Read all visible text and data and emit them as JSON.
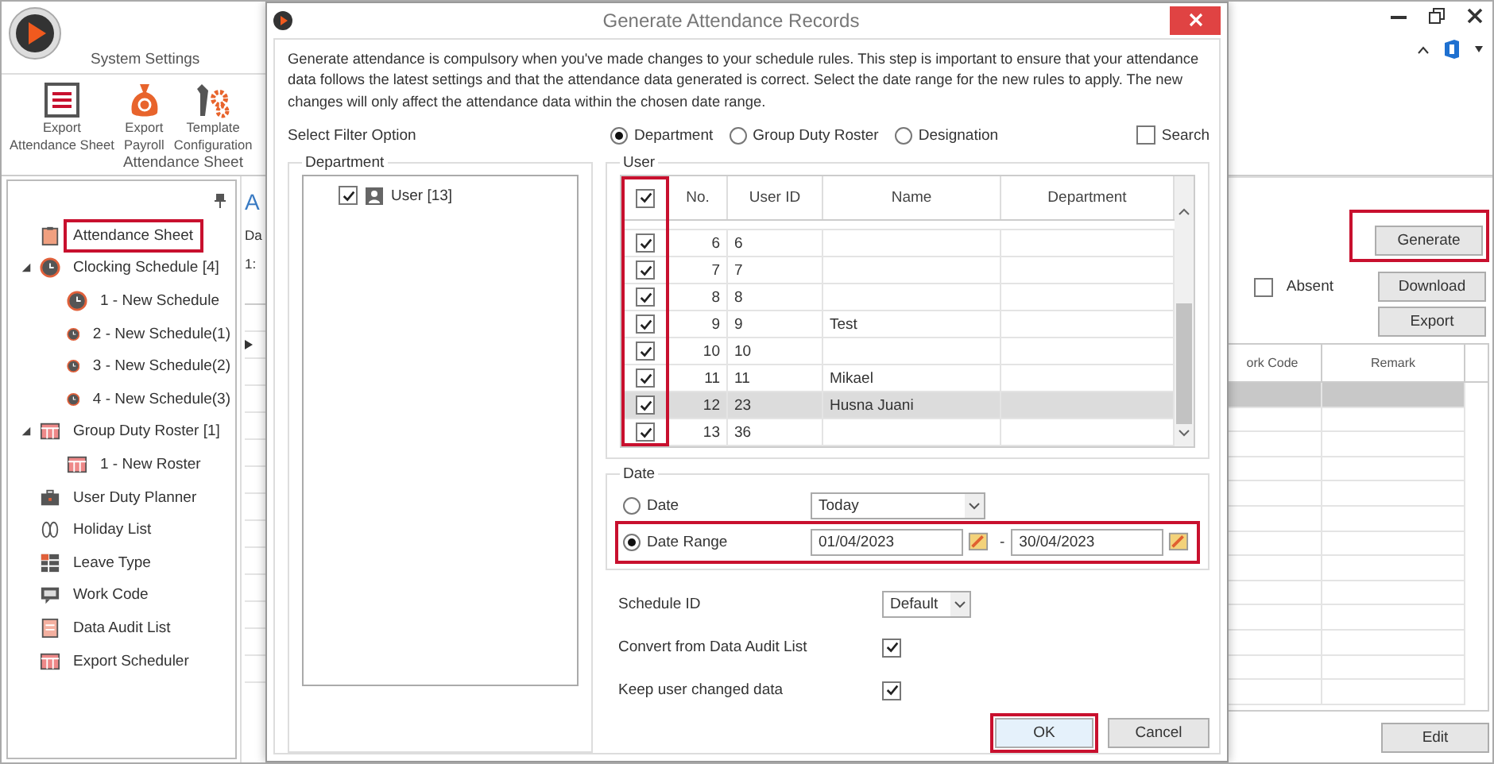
{
  "ribbon": {
    "tab": "System Settings",
    "tools": [
      {
        "kind": "sheet",
        "lines": [
          "Export",
          "Attendance Sheet"
        ]
      },
      {
        "kind": "payroll",
        "lines": [
          "Export",
          "Payroll"
        ]
      },
      {
        "kind": "config",
        "lines": [
          "Template",
          "Configuration"
        ]
      }
    ],
    "group_label": "Attendance Sheet"
  },
  "navigation": {
    "items": [
      {
        "kind": "sheet",
        "label": "Attendance Sheet",
        "highlighted": true
      },
      {
        "kind": "clock",
        "label": "Clocking Schedule [4]",
        "expanded": true,
        "children": [
          {
            "kind": "clock",
            "label": "1 - New Schedule"
          },
          {
            "kind": "clock",
            "label": "2 - New Schedule(1)"
          },
          {
            "kind": "clock",
            "label": "3 - New Schedule(2)"
          },
          {
            "kind": "clock",
            "label": "4 - New Schedule(3)"
          }
        ]
      },
      {
        "kind": "roster",
        "label": "Group Duty Roster [1]",
        "expanded": true,
        "children": [
          {
            "kind": "roster",
            "label": "1 - New Roster"
          }
        ]
      },
      {
        "kind": "planner",
        "label": "User Duty Planner"
      },
      {
        "kind": "holiday",
        "label": "Holiday List"
      },
      {
        "kind": "leave",
        "label": "Leave Type"
      },
      {
        "kind": "code",
        "label": "Work Code"
      },
      {
        "kind": "audit",
        "label": "Data Audit List"
      },
      {
        "kind": "export",
        "label": "Export Scheduler"
      }
    ]
  },
  "content": {
    "title": "A",
    "field_label": "Da",
    "field_value": "1:"
  },
  "actions": {
    "generate": {
      "label": "Generate",
      "highlighted": true
    },
    "absent": {
      "label": "Absent",
      "checked": false
    },
    "download": "Download",
    "export": "Export",
    "columns": [
      "ork Code",
      "Remark"
    ],
    "edit": "Edit"
  },
  "dialog": {
    "title": "Generate Attendance Records",
    "description": "Generate attendance is compulsory when you've made changes to your schedule rules. This step is important to ensure that your attendance data follows the latest settings and that the attendance data generated is correct. Select the date range for the new rules to apply. The new changes will only affect the attendance data within the chosen date range.",
    "filter_label": "Select Filter Option",
    "filter_options": [
      {
        "label": "Department",
        "selected": true
      },
      {
        "label": "Group Duty Roster",
        "selected": false
      },
      {
        "label": "Designation",
        "selected": false
      }
    ],
    "search": {
      "label": "Search",
      "checked": false
    },
    "department": {
      "title": "Department",
      "items": [
        {
          "label": "User [13]",
          "checked": true
        }
      ]
    },
    "users": {
      "title": "User",
      "all_checked": true,
      "check_column_highlighted": true,
      "columns": [
        "No.",
        "User ID",
        "Name",
        "Department"
      ],
      "rows": [
        {
          "checked": true,
          "no": "6",
          "user_id": "6",
          "name": "",
          "department": "",
          "selected": false
        },
        {
          "checked": true,
          "no": "7",
          "user_id": "7",
          "name": "",
          "department": "",
          "selected": false
        },
        {
          "checked": true,
          "no": "8",
          "user_id": "8",
          "name": "",
          "department": "",
          "selected": false
        },
        {
          "checked": true,
          "no": "9",
          "user_id": "9",
          "name": "Test",
          "department": "",
          "selected": false
        },
        {
          "checked": true,
          "no": "10",
          "user_id": "10",
          "name": "",
          "department": "",
          "selected": false
        },
        {
          "checked": true,
          "no": "11",
          "user_id": "11",
          "name": "Mikael",
          "department": "",
          "selected": false
        },
        {
          "checked": true,
          "no": "12",
          "user_id": "23",
          "name": "Husna Juani",
          "department": "",
          "selected": true
        },
        {
          "checked": true,
          "no": "13",
          "user_id": "36",
          "name": "",
          "department": "",
          "selected": false
        }
      ]
    },
    "date": {
      "title": "Date",
      "single": {
        "label": "Date",
        "selected": false,
        "value": "Today"
      },
      "range": {
        "label": "Date Range",
        "selected": true,
        "highlighted": true,
        "from": "01/04/2023",
        "separator": "-",
        "to": "30/04/2023"
      }
    },
    "schedule": {
      "label": "Schedule ID",
      "value": "Default"
    },
    "options": [
      {
        "label": "Convert from Data Audit List",
        "checked": true
      },
      {
        "label": "Keep user changed data",
        "checked": true
      }
    ],
    "ok": {
      "label": "OK",
      "highlighted": true
    },
    "cancel": "Cancel"
  }
}
